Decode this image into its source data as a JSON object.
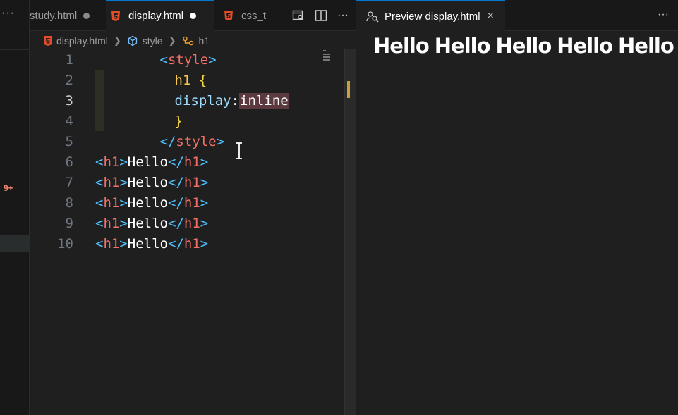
{
  "sidebar": {
    "more_label": "···",
    "problems_badge": "9+"
  },
  "tabs": [
    {
      "label": "study.html",
      "modified": true,
      "active": false
    },
    {
      "label": "display.html",
      "modified": true,
      "active": true
    },
    {
      "label": "css_t",
      "active": false
    }
  ],
  "tab_actions": {
    "more_label": "···"
  },
  "breadcrumb": {
    "file": "display.html",
    "style": "style",
    "h1": "h1"
  },
  "code": {
    "line_numbers": [
      "1",
      "2",
      "3",
      "4",
      "5",
      "6",
      "7",
      "8",
      "9",
      "10"
    ],
    "lines": [
      {
        "open": "<",
        "tag": "style",
        "close": ">"
      },
      {
        "selector": "h1",
        "brace": "{"
      },
      {
        "property": "display",
        "colon": ":",
        "value": "inline"
      },
      {
        "brace": "}"
      },
      {
        "open": "</",
        "tag": "style",
        "close": ">"
      },
      {
        "text": "Hello"
      },
      {
        "text": "Hello"
      },
      {
        "text": "Hello"
      },
      {
        "text": "Hello"
      },
      {
        "text": "Hello"
      }
    ],
    "h1_open": "<h1>",
    "h1_close": "</h1>"
  },
  "preview": {
    "tab_label": "Preview display.html",
    "close_label": "×",
    "more_label": "···",
    "headings": [
      "Hello",
      "Hello",
      "Hello",
      "Hello",
      "Hello"
    ]
  },
  "colors": {
    "accent": "#0078d4",
    "tag": "#f47067",
    "bracket": "#4fc1ff",
    "brace": "#f9d849",
    "property": "#9cdcfe",
    "html_icon": "#e44d26"
  }
}
